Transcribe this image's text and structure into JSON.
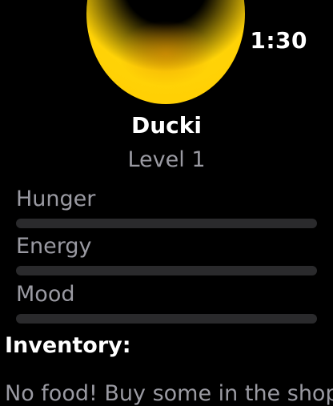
{
  "status": {
    "time": "1:30"
  },
  "pet": {
    "name": "Ducki",
    "level": "Level 1",
    "color": "#ffcc00"
  },
  "stats": [
    {
      "label": "Hunger",
      "fraction": 0
    },
    {
      "label": "Energy",
      "fraction": 0
    },
    {
      "label": "Mood",
      "fraction": 0
    }
  ],
  "inventory": {
    "title": "Inventory:",
    "empty_message": "No food! Buy some in the shop"
  }
}
